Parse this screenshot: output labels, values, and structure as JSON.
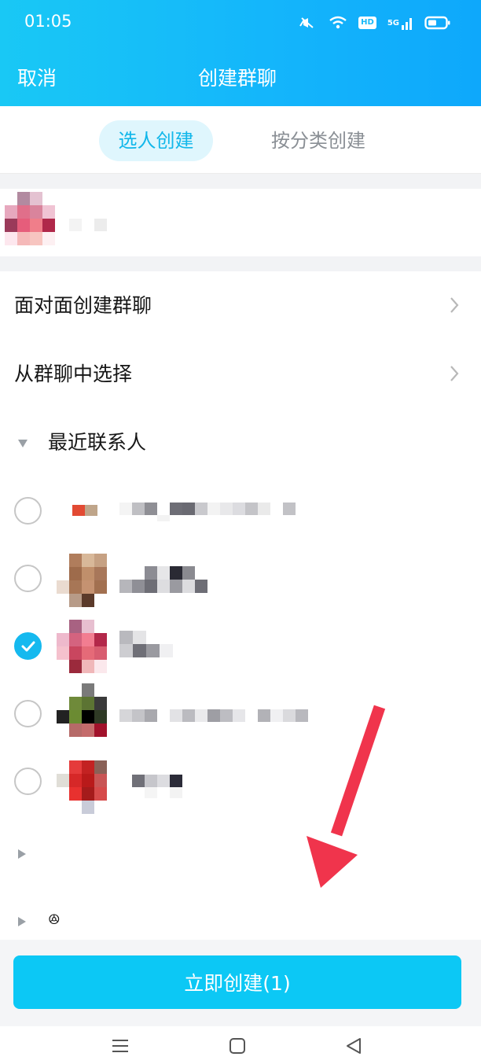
{
  "status_bar": {
    "time": "01:05",
    "network": "5G",
    "hd": "HD"
  },
  "header": {
    "cancel_label": "取消",
    "title": "创建群聊"
  },
  "tabs": [
    {
      "label": "选人创建",
      "active": true
    },
    {
      "label": "按分类创建",
      "active": false
    }
  ],
  "menu": [
    {
      "label": "面对面创建群聊"
    },
    {
      "label": "从群聊中选择"
    }
  ],
  "recent_section": {
    "label": "最近联系人",
    "expanded": true
  },
  "contacts": [
    {
      "name": "",
      "checked": false
    },
    {
      "name": "",
      "checked": false
    },
    {
      "name": "",
      "checked": true
    },
    {
      "name": "",
      "checked": false
    },
    {
      "name": "",
      "checked": false
    }
  ],
  "collapsed_groups": [
    {
      "label": ""
    },
    {
      "label": "ꔮ"
    }
  ],
  "create_button": {
    "label": "立即创建(1)"
  },
  "colors": {
    "accent": "#0cc8f5",
    "header": "#14b6fb",
    "annotation_arrow": "#f0344c"
  }
}
